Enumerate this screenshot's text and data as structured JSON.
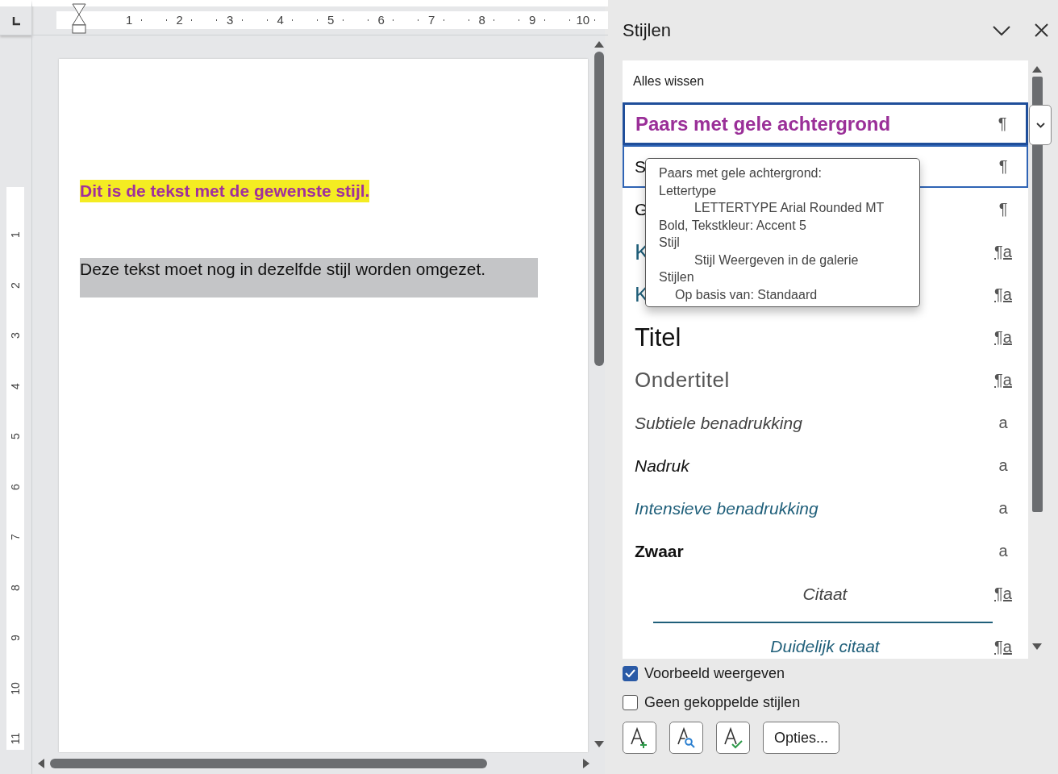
{
  "ruler": {
    "horizontal_marks": [
      "1",
      "2",
      "3",
      "4",
      "5",
      "6",
      "7",
      "8",
      "9",
      "10"
    ],
    "vertical_marks": [
      "1",
      "2",
      "3",
      "4",
      "5",
      "6",
      "7",
      "8",
      "9",
      "10",
      "11"
    ]
  },
  "document": {
    "paragraphs": [
      {
        "text": "Dit is de tekst met de gewenste stijl.",
        "kind": "highlighted"
      },
      {
        "text": "Deze tekst moet nog in dezelfde stijl worden omgezet.",
        "kind": "selected"
      }
    ]
  },
  "styles_pane": {
    "title": "Stijlen",
    "clear_all": "Alles wissen",
    "styles": [
      {
        "name": "Paars met gele achtergrond",
        "kind": "custom",
        "mark": "¶",
        "linked": false,
        "selected": true,
        "hovered": false
      },
      {
        "name": "S",
        "kind": "normal",
        "mark": "¶",
        "linked": false,
        "selected": false,
        "hovered": true
      },
      {
        "name": "G",
        "kind": "normal",
        "mark": "¶",
        "linked": false,
        "selected": false,
        "hovered": false
      },
      {
        "name": "K",
        "kind": "heading1",
        "mark": "¶a",
        "linked": true,
        "selected": false,
        "hovered": false
      },
      {
        "name": "K",
        "kind": "heading2",
        "mark": "¶a",
        "linked": true,
        "selected": false,
        "hovered": false
      },
      {
        "name": "Titel",
        "kind": "title",
        "mark": "¶a",
        "linked": true,
        "selected": false,
        "hovered": false
      },
      {
        "name": "Ondertitel",
        "kind": "subtitle",
        "mark": "¶a",
        "linked": true,
        "selected": false,
        "hovered": false
      },
      {
        "name": "Subtiele benadrukking",
        "kind": "subtle",
        "mark": "a",
        "linked": false,
        "selected": false,
        "hovered": false
      },
      {
        "name": "Nadruk",
        "kind": "emphasis",
        "mark": "a",
        "linked": false,
        "selected": false,
        "hovered": false
      },
      {
        "name": "Intensieve benadrukking",
        "kind": "intense",
        "mark": "a",
        "linked": false,
        "selected": false,
        "hovered": false
      },
      {
        "name": "Zwaar",
        "kind": "strong",
        "mark": "a",
        "linked": false,
        "selected": false,
        "hovered": false
      },
      {
        "name": "Citaat",
        "kind": "quote",
        "mark": "¶a",
        "linked": true,
        "selected": false,
        "hovered": false
      },
      {
        "name": "Duidelijk citaat",
        "kind": "intensequote",
        "mark": "¶a",
        "linked": true,
        "selected": false,
        "hovered": false
      }
    ],
    "tooltip": {
      "lines": [
        {
          "text": "Paars met gele achtergrond:",
          "kind": "label"
        },
        {
          "text": "Lettertype",
          "kind": "label"
        },
        {
          "text": "LETTERTYPE Arial Rounded MT",
          "kind": "detail"
        },
        {
          "text": "Bold, Tekstkleur: Accent 5",
          "kind": "label"
        },
        {
          "text": "Stijl",
          "kind": "label"
        },
        {
          "text": "Stijl Weergeven in de galerie",
          "kind": "detail"
        },
        {
          "text": "Stijlen",
          "kind": "label"
        },
        {
          "text": "Op basis van: Standaard",
          "kind": "note"
        }
      ]
    },
    "options": [
      {
        "label": "Voorbeeld weergeven",
        "checked": true
      },
      {
        "label": "Geen gekoppelde stijlen",
        "checked": false
      }
    ],
    "buttons": [
      {
        "kind": "new-style"
      },
      {
        "kind": "inspect"
      },
      {
        "kind": "manage"
      },
      {
        "kind": "text",
        "label": "Opties..."
      }
    ]
  }
}
